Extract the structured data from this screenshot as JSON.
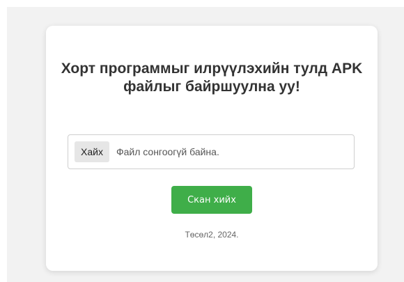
{
  "upload": {
    "title": "Хорт программыг илрүүлэхийн тулд APK файлыг байршуулна уу!",
    "browse_label": "Хайх",
    "file_status": "Файл сонгоогүй байна.",
    "scan_label": "Скан хийх"
  },
  "footer": {
    "text": "Төсөл2, 2024."
  },
  "colors": {
    "accent": "#3fae49"
  }
}
